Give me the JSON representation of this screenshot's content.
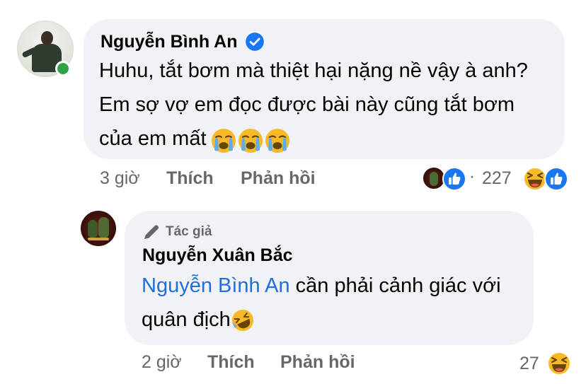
{
  "comment": {
    "author": "Nguyễn Bình An",
    "verified": true,
    "text_lines": [
      "Huhu, tắt bơm mà thiệt hại nặng nề vậy à anh?",
      "Em sợ vợ em đọc được bài này cũng tắt bơm",
      "của em mất"
    ],
    "emoji": [
      "loudly-crying-face",
      "loudly-crying-face",
      "loudly-crying-face"
    ],
    "time": "3 giờ",
    "like_label": "Thích",
    "reply_label": "Phản hồi",
    "reactions": {
      "types": [
        "like",
        "haha",
        "like"
      ],
      "separator": "·",
      "count": "227"
    },
    "online": true
  },
  "reply": {
    "badge_label": "Tác giả",
    "badge_icon": "pen-icon",
    "author": "Nguyễn Xuân Bắc",
    "mention": "Nguyễn Bình An",
    "text_after_mention": " cần phải cảnh giác với",
    "text_line2": "quân địch",
    "emoji": [
      "rolling-on-floor-laughing"
    ],
    "time": "2 giờ",
    "like_label": "Thích",
    "reply_label": "Phản hồi",
    "reactions": {
      "types": [
        "haha"
      ],
      "count": "27"
    }
  },
  "colors": {
    "bubble_bg": "#f0f2f5",
    "text": "#050505",
    "secondary_text": "#65676b",
    "mention": "#216fdb",
    "verified_blue": "#1877f2",
    "online_green": "#31a24c",
    "like_blue": "#1877f2",
    "haha_yellow": "#f7b928"
  }
}
